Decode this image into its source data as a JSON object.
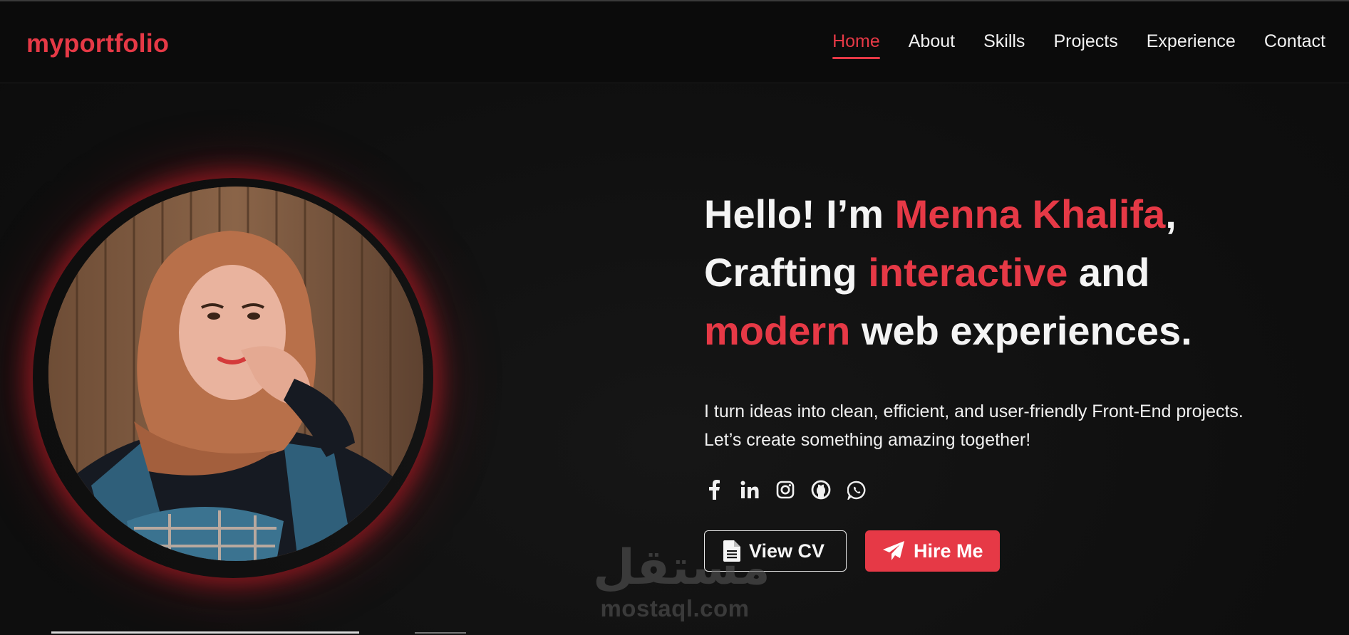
{
  "brand": {
    "logo": "myportfolio",
    "accent_color": "#e63946"
  },
  "nav": {
    "items": [
      {
        "label": "Home",
        "active": true
      },
      {
        "label": "About",
        "active": false
      },
      {
        "label": "Skills",
        "active": false
      },
      {
        "label": "Projects",
        "active": false
      },
      {
        "label": "Experience",
        "active": false
      },
      {
        "label": "Contact",
        "active": false
      }
    ]
  },
  "hero": {
    "line1_pre": "Hello! I’m ",
    "line1_name": "Menna Khalifa",
    "line1_post": ",",
    "line2_pre": "Crafting ",
    "line2_accent": "interactive",
    "line2_post": " and",
    "line3_accent": "modern",
    "line3_post": " web experiences.",
    "sub_line1": "I turn ideas into clean, efficient, and user-friendly Front-End projects.",
    "sub_line2": "Let’s create something amazing together!",
    "socials": [
      "facebook-icon",
      "linkedin-icon",
      "instagram-icon",
      "github-icon",
      "whatsapp-icon"
    ],
    "btn_cv": "View CV",
    "btn_hire": "Hire Me",
    "avatar_alt": "profile-photo"
  },
  "watermark": {
    "arabic": "مستقل",
    "latin": "mostaql.com"
  }
}
